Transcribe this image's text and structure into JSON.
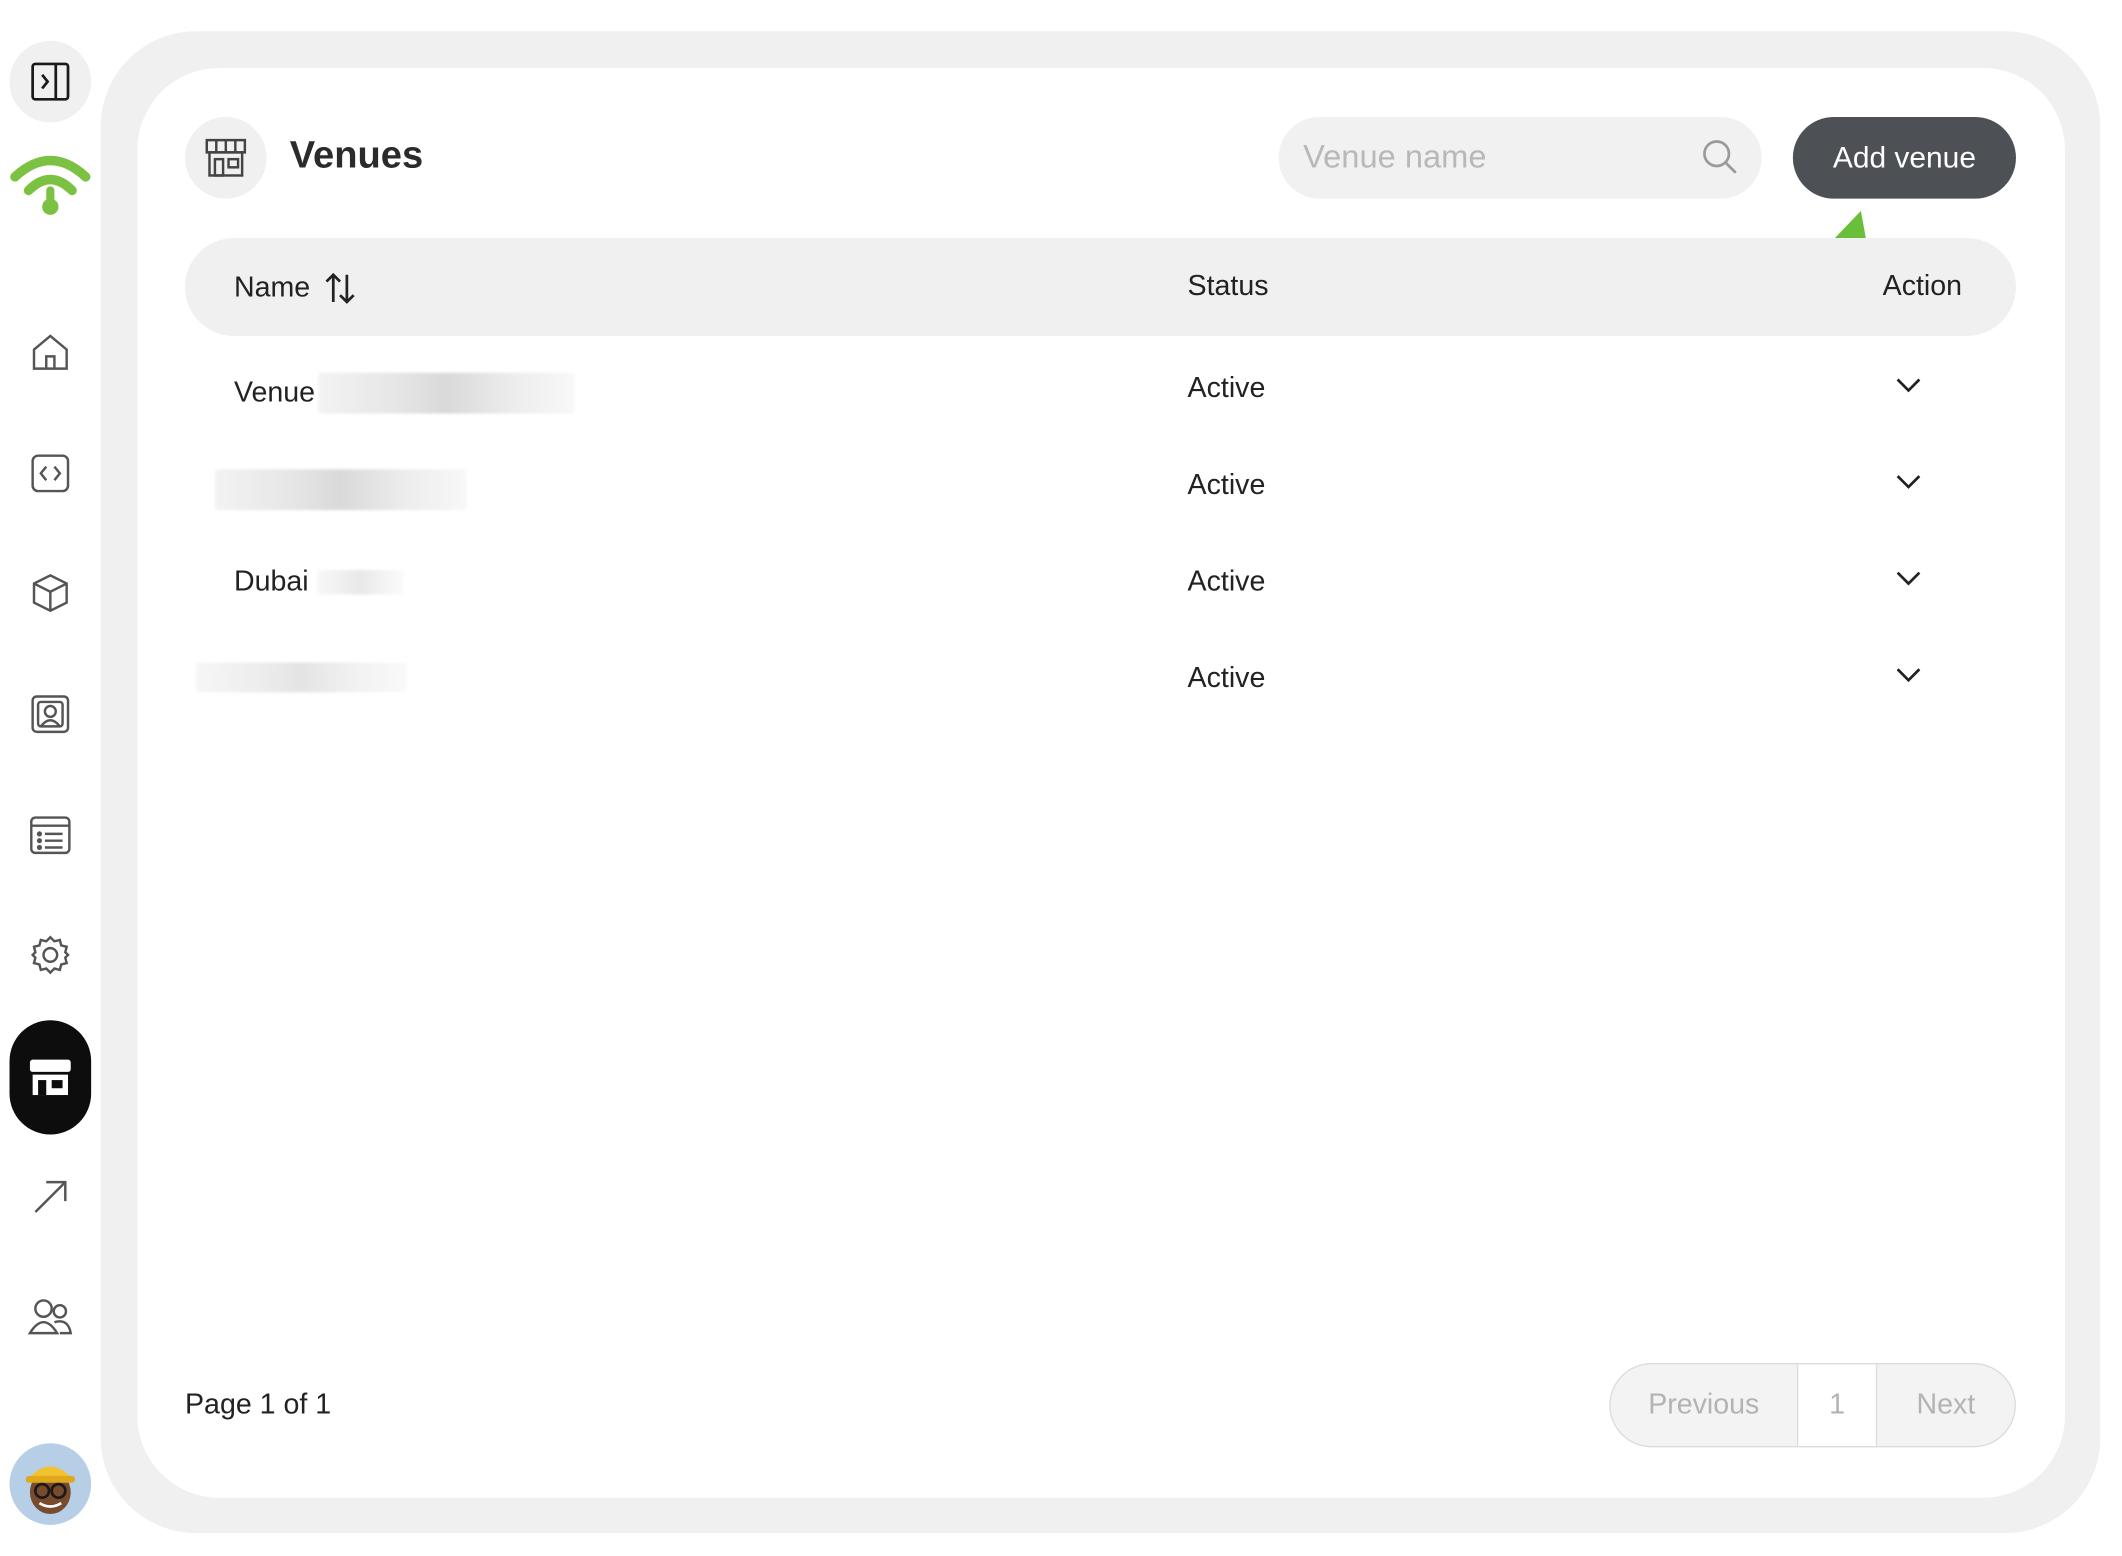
{
  "header": {
    "title": "Venues",
    "search_placeholder": "Venue name",
    "add_button_label": "Add venue"
  },
  "table": {
    "columns": {
      "name": "Name",
      "status": "Status",
      "action": "Action"
    },
    "rows": [
      {
        "name": "Venue",
        "status": "Active"
      },
      {
        "name": "",
        "status": "Active"
      },
      {
        "name": "Dubai",
        "status": "Active"
      },
      {
        "name": "",
        "status": "Active"
      }
    ]
  },
  "pagination": {
    "summary": "Page 1 of 1",
    "previous_label": "Previous",
    "current_page": "1",
    "next_label": "Next"
  },
  "colors": {
    "brand_green": "#7cc242",
    "active_nav": "#0d0d0d",
    "primary_button": "#4d5055",
    "annotation_arrow": "#6abf3a"
  },
  "sidebar": {
    "icons": [
      "panel-toggle-icon",
      "wifi-logo-icon",
      "home-icon",
      "code-icon",
      "cube-icon",
      "contact-card-icon",
      "list-icon",
      "gear-icon",
      "storefront-icon",
      "arrow-up-right-icon",
      "users-icon"
    ]
  }
}
